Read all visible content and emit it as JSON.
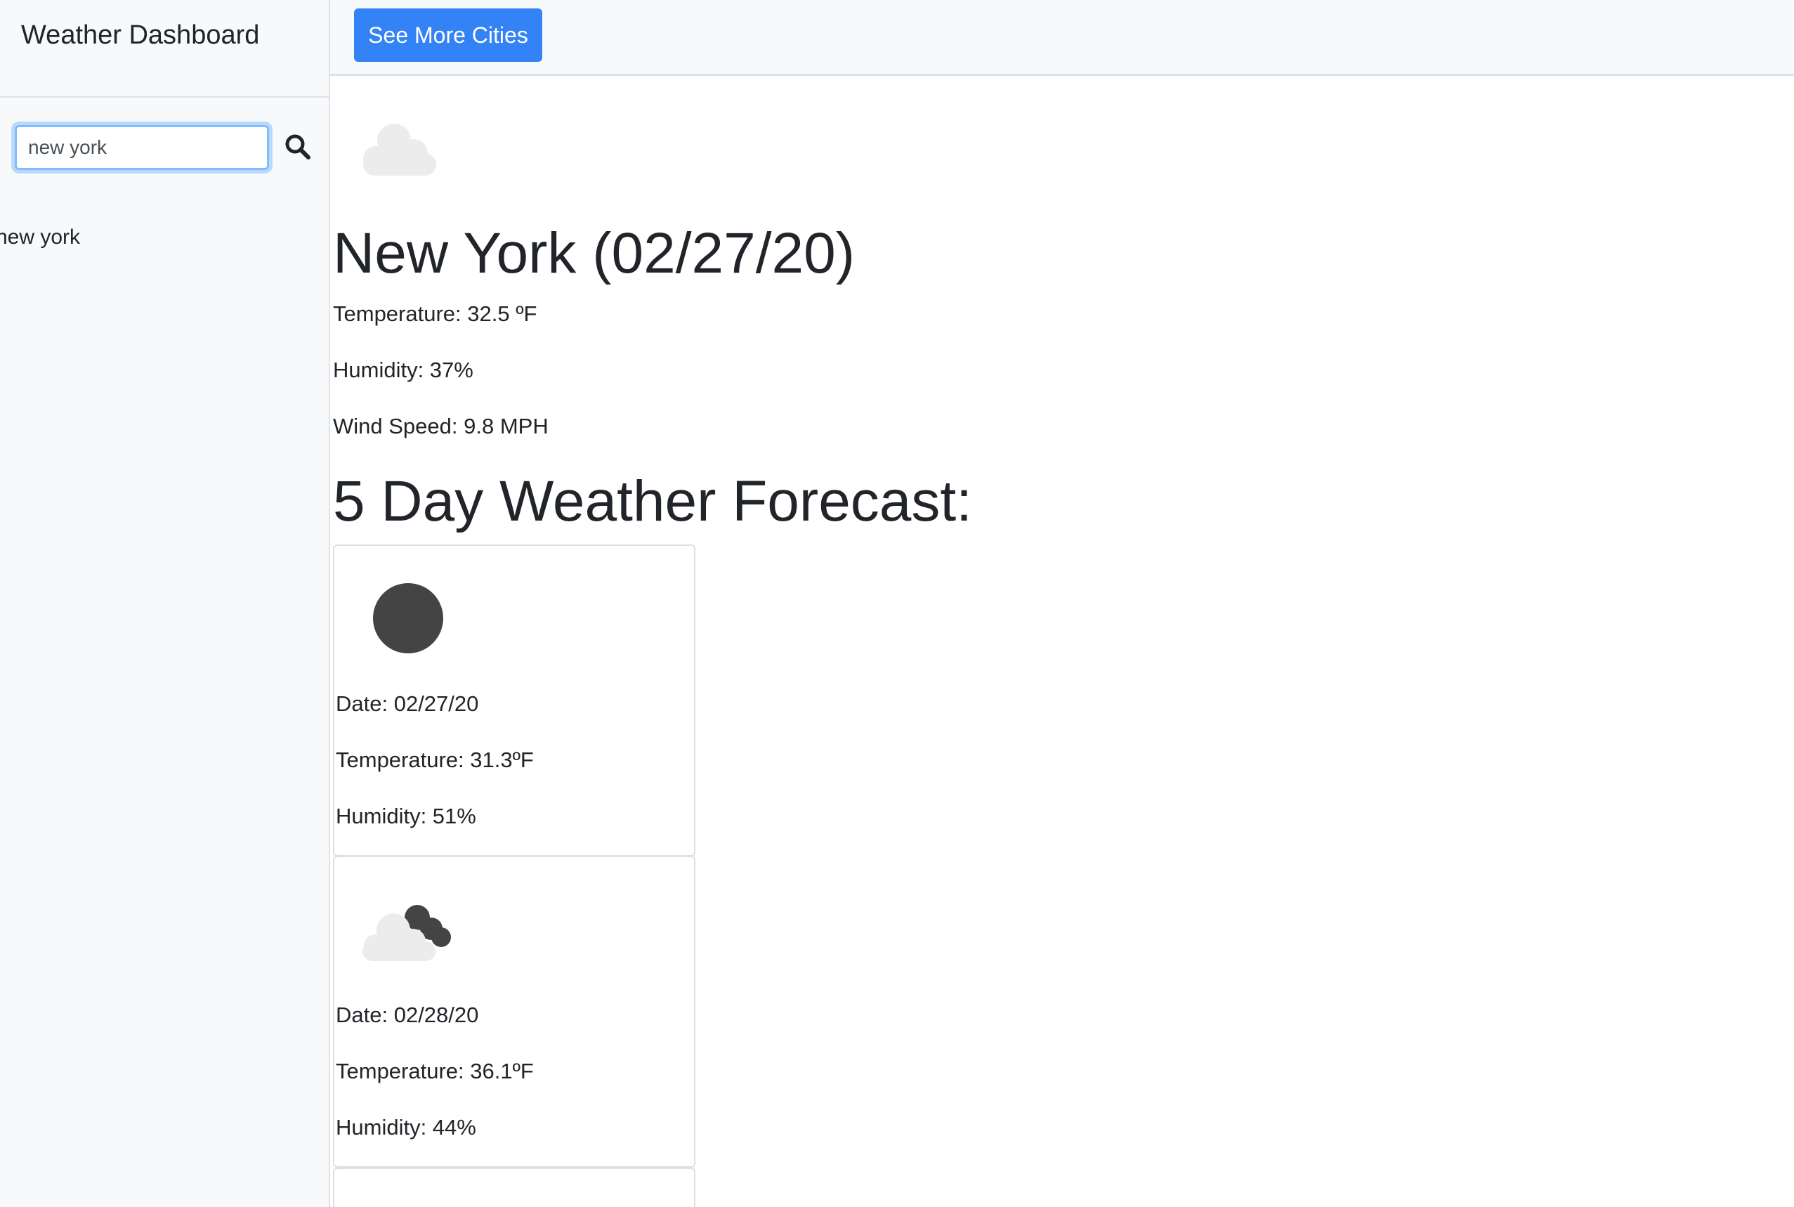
{
  "sidebar": {
    "title": "Weather Dashboard",
    "search": {
      "value": "new york",
      "icon": "search-icon"
    },
    "history": [
      {
        "label": "new york"
      }
    ]
  },
  "header": {
    "more_cities_label": "See More Cities"
  },
  "current": {
    "icon": "cloud-icon",
    "title": "New York (02/27/20)",
    "temperature": "Temperature: 32.5 ºF",
    "humidity": "Humidity: 37%",
    "wind": "Wind Speed: 9.8 MPH"
  },
  "forecast": {
    "heading": "5 Day Weather Forecast:",
    "days": [
      {
        "icon": "moon-icon",
        "date": "Date: 02/27/20",
        "temperature": "Temperature: 31.3ºF",
        "humidity": "Humidity: 51%"
      },
      {
        "icon": "cloudy-night-icon",
        "date": "Date: 02/28/20",
        "temperature": "Temperature: 36.1ºF",
        "humidity": "Humidity: 44%"
      }
    ]
  },
  "colors": {
    "accent": "#3483f6",
    "sidebar_background": "#f8f9fa",
    "text": "#212529"
  }
}
